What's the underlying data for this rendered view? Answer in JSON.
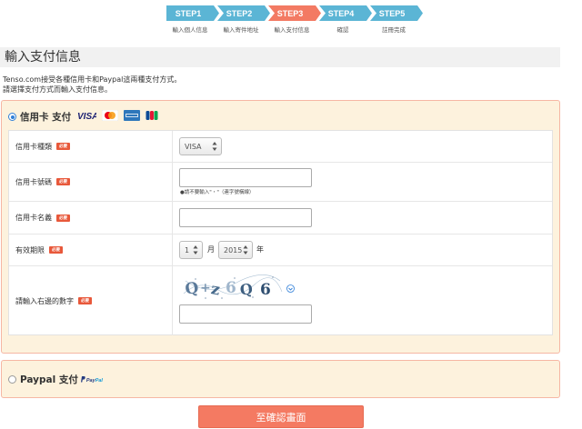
{
  "steps": [
    {
      "label": "STEP1",
      "caption": "輸入個人信息",
      "color": "#5bb5d5"
    },
    {
      "label": "STEP2",
      "caption": "輸入寄件地址",
      "color": "#5bb5d5"
    },
    {
      "label": "STEP3",
      "caption": "輸入支付信息",
      "color": "#f37a63"
    },
    {
      "label": "STEP4",
      "caption": "確認",
      "color": "#5bb5d5"
    },
    {
      "label": "STEP5",
      "caption": "註冊完成",
      "color": "#5bb5d5"
    }
  ],
  "page_title": "輸入支付信息",
  "intro": {
    "line1": "Tenso.com接受各種信用卡和Paypal這兩種支付方式。",
    "line2": "請選擇支付方式而輸入支付信息。"
  },
  "card_section": {
    "label": "信用卡 支付",
    "selected": true,
    "brands": [
      "visa-logo",
      "mastercard-logo",
      "amex-logo",
      "jcb-logo"
    ],
    "visa_text": "VISA"
  },
  "form": {
    "required_badge": "必要",
    "card_type": {
      "label": "信用卡種類",
      "value": "VISA"
    },
    "card_number": {
      "label": "信用卡號碼",
      "value": "",
      "note": "●請不要輸入\"・\"（連字號橫線）"
    },
    "card_name": {
      "label": "信用卡名義",
      "value": ""
    },
    "expiry": {
      "label": "有效期限",
      "month": "1",
      "month_unit": "月",
      "year": "2015",
      "year_unit": "年"
    },
    "captcha": {
      "label": "請輸入右邊的數字",
      "image_alt": "Q+z6Q6",
      "value": ""
    }
  },
  "paypal_section": {
    "label": "Paypal 支付",
    "selected": false,
    "logo_text_pay": "Pay",
    "logo_text_pal": "Pal"
  },
  "confirm_button": {
    "label": "至確認畫面",
    "color": "#f47a62"
  }
}
